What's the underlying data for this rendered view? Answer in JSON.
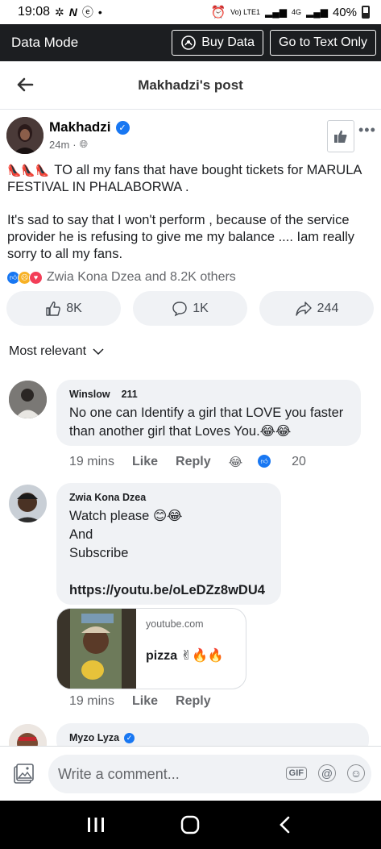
{
  "status": {
    "time": "19:08",
    "network_label": "Vo) LTE1",
    "net_type": "4G",
    "battery": "40%"
  },
  "data_bar": {
    "title": "Data Mode",
    "buy_data": "Buy Data",
    "text_only": "Go to Text Only"
  },
  "header": {
    "title": "Makhadzi's post"
  },
  "post": {
    "author": "Makhadzi",
    "time": "24m",
    "line1": "TO all my fans that have bought tickets for MARULA FESTIVAL IN PHALABORWA .",
    "line2": "It's sad to say  that I won't perform , because of the service provider he is refusing to give me my balance ....   Iam really sorry to all my fans.",
    "reactions_text": "Zwia Kona Dzea and 8.2K others",
    "likes": "8K",
    "comments": "1K",
    "shares": "244"
  },
  "sort": {
    "label": "Most relevant"
  },
  "comments": [
    {
      "name": "Winslow",
      "count": "211",
      "text": "No one can Identify a girl that LOVE you faster than another girl that Loves You.😂😂",
      "time": "19 mins",
      "like": "Like",
      "reply": "Reply",
      "reaction_count": "20"
    },
    {
      "name": "Zwia Kona Dzea",
      "text_lines": [
        "Watch please 😊😂",
        "And",
        "Subscribe"
      ],
      "link": "https://youtu.be/oLeDZz8wDU4",
      "card_domain": "youtube.com",
      "card_title": "pizza ✌🔥🔥",
      "time": "19 mins",
      "like": "Like",
      "reply": "Reply"
    },
    {
      "name": "Myzo Lyza"
    }
  ],
  "composer": {
    "placeholder": "Write a comment...",
    "gif": "GIF",
    "at": "@"
  },
  "colors": {
    "accent": "#1877f2",
    "dark_bar": "#1c1e21",
    "bubble": "#f0f2f5"
  }
}
